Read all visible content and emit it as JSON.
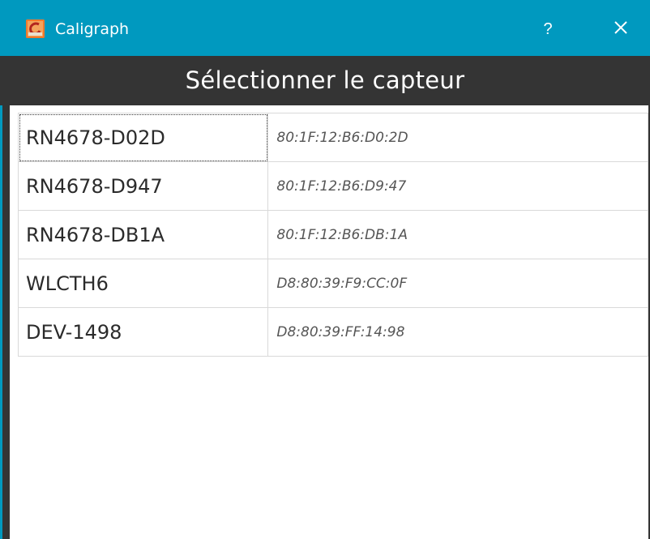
{
  "window": {
    "title": "Caligraph",
    "help_label": "?",
    "icons": {
      "app": "caligraph-app-icon",
      "close": "close-icon"
    },
    "colors": {
      "titlebar": "#0099bf",
      "header_band": "#343434",
      "title_text": "#ffffff"
    }
  },
  "dialog": {
    "heading": "Sélectionner le capteur"
  },
  "sensors": [
    {
      "name": "RN4678-D02D",
      "mac": "80:1F:12:B6:D0:2D",
      "selected": true
    },
    {
      "name": "RN4678-D947",
      "mac": "80:1F:12:B6:D9:47",
      "selected": false
    },
    {
      "name": "RN4678-DB1A",
      "mac": "80:1F:12:B6:DB:1A",
      "selected": false
    },
    {
      "name": "WLCTH6",
      "mac": "D8:80:39:F9:CC:0F",
      "selected": false
    },
    {
      "name": "DEV-1498",
      "mac": "D8:80:39:FF:14:98",
      "selected": false
    }
  ]
}
